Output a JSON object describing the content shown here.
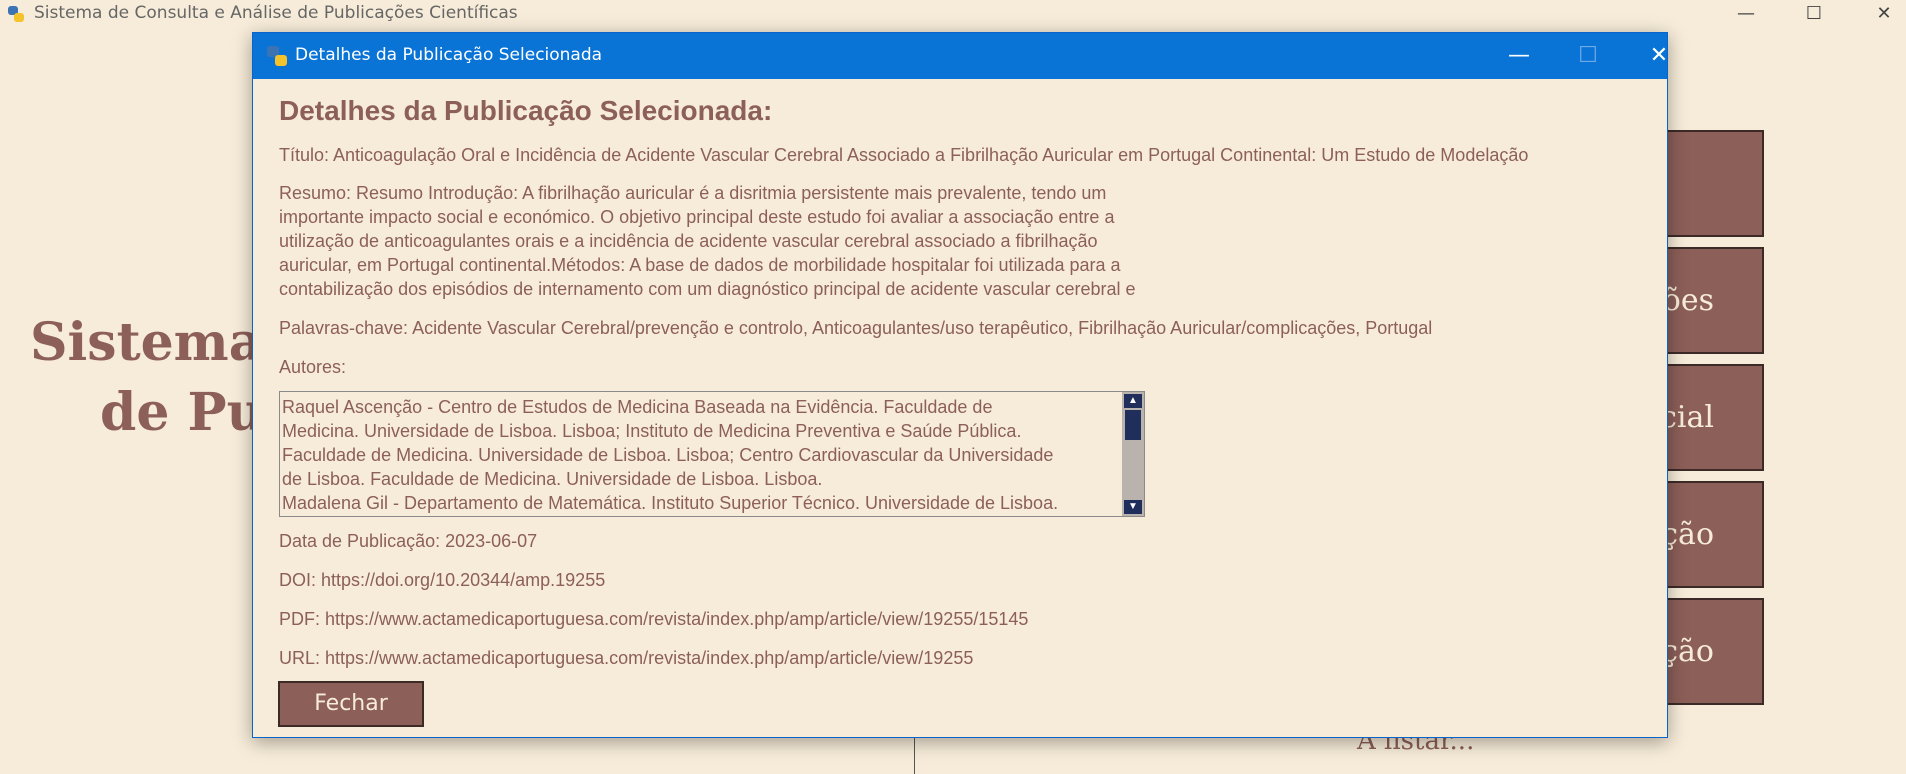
{
  "main_window": {
    "title": "Sistema de Consulta e Análise de Publicações Científicas",
    "controls": {
      "minimize": "—",
      "maximize": "☐",
      "close": "✕"
    }
  },
  "background": {
    "title_line1": "Sistema",
    "title_line2": "de Pu",
    "menu_buttons": [
      "",
      "ações",
      "rcial",
      "ção",
      "ração"
    ],
    "status": "A listar..."
  },
  "dialog": {
    "title": "Detalhes da Publicação Selecionada",
    "controls": {
      "minimize": "—",
      "maximize": "☐",
      "close": "✕"
    },
    "heading": "Detalhes da Publicação Selecionada:",
    "titulo": "Título: Anticoagulação Oral e Incidência de Acidente Vascular Cerebral Associado a Fibrilhação Auricular em Portugal Continental: Um Estudo de Modelação",
    "resumo": "Resumo: Resumo Introdução: A fibrilhação auricular é a disritmia persistente mais prevalente, tendo um\nimportante impacto social e económico. O objetivo principal deste estudo foi avaliar a associação entre a\nutilização de anticoagulantes orais e a incidência de acidente vascular cerebral associado a fibrilhação\nauricular, em Portugal continental.Métodos: A base de dados de morbilidade hospitalar foi utilizada para a\ncontabilização dos episódios de internamento com um diagnóstico principal de acidente vascular cerebral e",
    "palavras_chave": "Palavras-chave: Acidente Vascular Cerebral/prevenção e controlo, Anticoagulantes/uso terapêutico, Fibrilhação Auricular/complicações, Portugal",
    "autores_label": "Autores:",
    "autores": "Raquel Ascenção - Centro de Estudos de Medicina Baseada na Evidência. Faculdade de\nMedicina. Universidade de Lisboa. Lisboa; Instituto de Medicina Preventiva e Saúde Pública.\nFaculdade de Medicina. Universidade de Lisboa. Lisboa; Centro Cardiovascular da Universidade\nde Lisboa. Faculdade de Medicina. Universidade de Lisboa. Lisboa.\nMadalena Gil - Departamento de Matemática. Instituto Superior Técnico. Universidade de Lisboa.",
    "data_publicacao": "Data de Publicação: 2023-06-07",
    "doi": "DOI: https://doi.org/10.20344/amp.19255",
    "pdf": "PDF: https://www.actamedicaportuguesa.com/revista/index.php/amp/article/view/19255/15145",
    "url": "URL: https://www.actamedicaportuguesa.com/revista/index.php/amp/article/view/19255",
    "close_label": "Fechar"
  }
}
